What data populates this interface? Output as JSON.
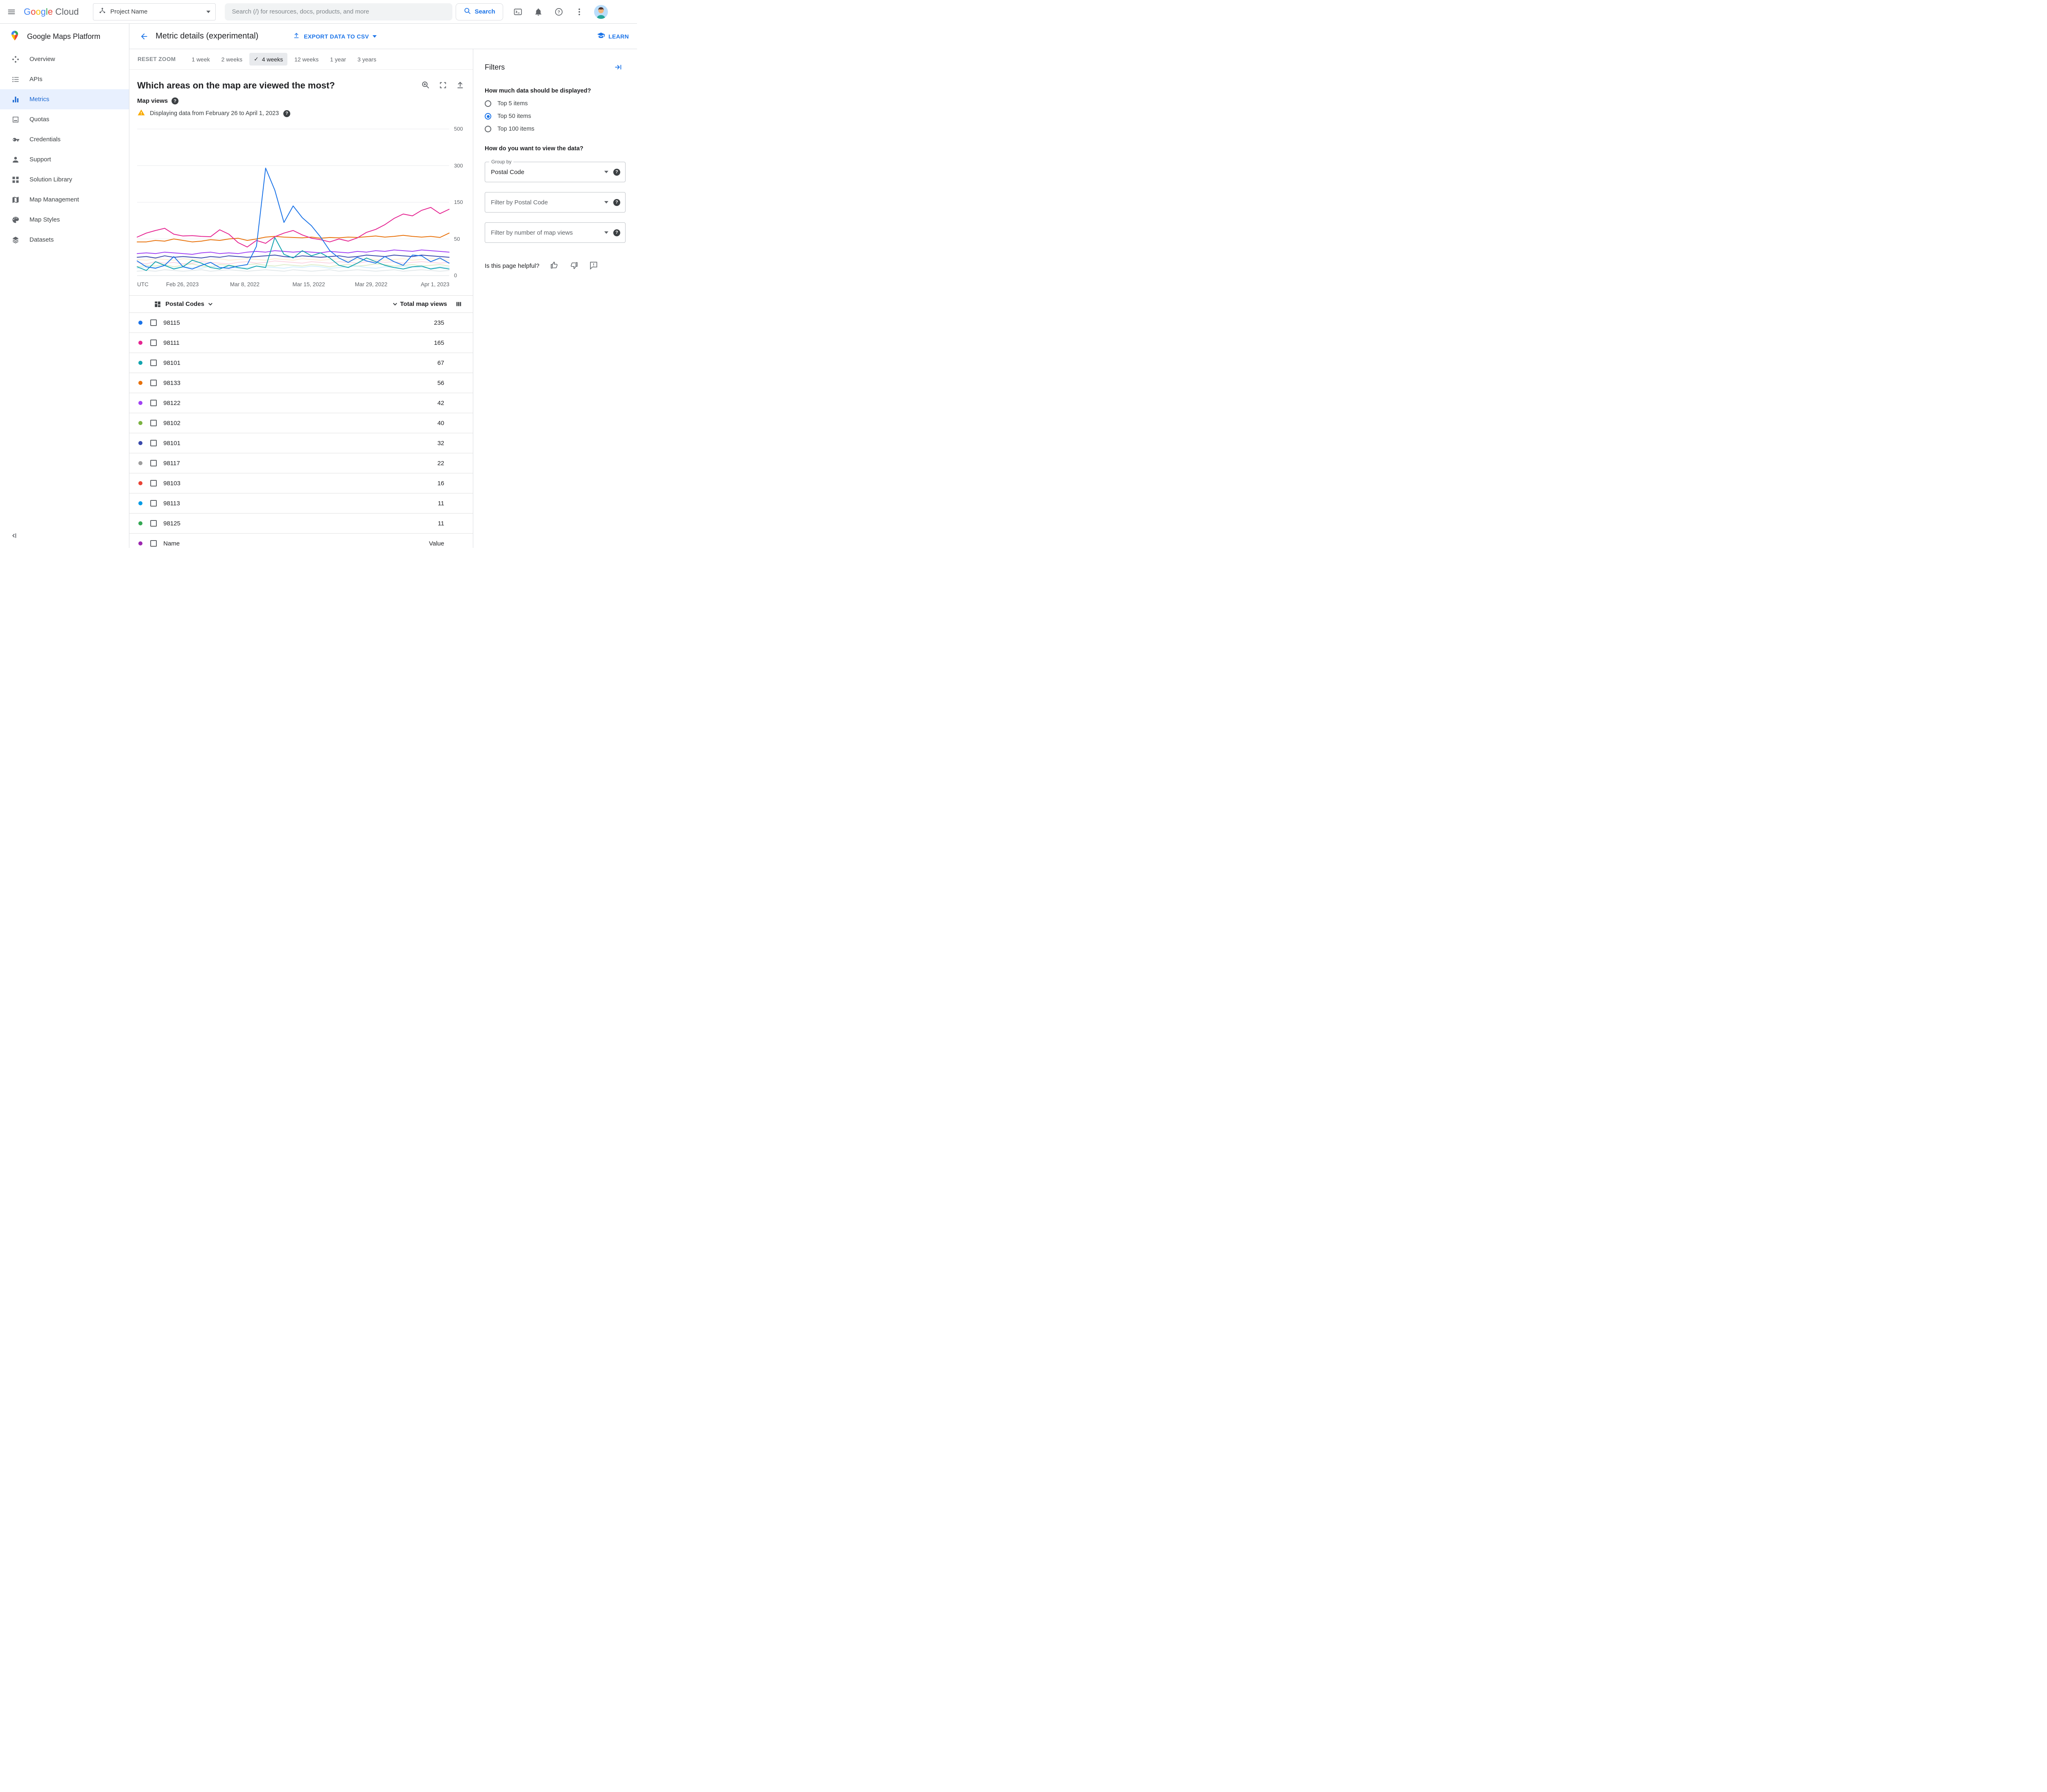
{
  "topbar": {
    "logo": {
      "brand_letters": [
        "G",
        "o",
        "o",
        "g",
        "l",
        "e"
      ],
      "letter_colors": [
        "#4285F4",
        "#EA4335",
        "#FBBC05",
        "#4285F4",
        "#34A853",
        "#EA4335"
      ],
      "suffix": "Cloud"
    },
    "project_selector": {
      "label": "Project Name"
    },
    "search": {
      "placeholder": "Search (/) for resources, docs, products, and more",
      "button_label": "Search"
    }
  },
  "sidebar": {
    "title": "Google Maps Platform",
    "items": [
      {
        "label": "Overview",
        "icon": "overview-icon",
        "active": false
      },
      {
        "label": "APIs",
        "icon": "apis-icon",
        "active": false
      },
      {
        "label": "Metrics",
        "icon": "metrics-icon",
        "active": true
      },
      {
        "label": "Quotas",
        "icon": "quotas-icon",
        "active": false
      },
      {
        "label": "Credentials",
        "icon": "credentials-icon",
        "active": false
      },
      {
        "label": "Support",
        "icon": "support-icon",
        "active": false
      },
      {
        "label": "Solution Library",
        "icon": "solution-library-icon",
        "active": false
      },
      {
        "label": "Map Management",
        "icon": "map-management-icon",
        "active": false
      },
      {
        "label": "Map Styles",
        "icon": "map-styles-icon",
        "active": false
      },
      {
        "label": "Datasets",
        "icon": "datasets-icon",
        "active": false
      }
    ]
  },
  "header": {
    "title": "Metric details (experimental)",
    "export_button": "EXPORT DATA TO CSV",
    "learn_link": "LEARN"
  },
  "time_controls": {
    "reset_label": "RESET ZOOM",
    "options": [
      {
        "label": "1 week",
        "selected": false
      },
      {
        "label": "2 weeks",
        "selected": false
      },
      {
        "label": "4 weeks",
        "selected": true
      },
      {
        "label": "12 weeks",
        "selected": false
      },
      {
        "label": "1 year",
        "selected": false
      },
      {
        "label": "3 years",
        "selected": false
      }
    ]
  },
  "chart_section": {
    "question": "Which areas on the map are viewed the most?",
    "metric_label": "Map views",
    "warning_text": "Displaying data from February 26 to April 1, 2023"
  },
  "chart_data": {
    "type": "line",
    "title": "Which areas on the map are viewed the most?",
    "ylabel": "Map views",
    "yticks": [
      0,
      50,
      150,
      300,
      500
    ],
    "grid": true,
    "timezone_label": "UTC",
    "x_axis_labels": [
      {
        "label": "Feb 26, 2023",
        "pos": 0.145
      },
      {
        "label": "Mar 8, 2022",
        "pos": 0.345
      },
      {
        "label": "Mar 15, 2022",
        "pos": 0.55
      },
      {
        "label": "Mar 29, 2022",
        "pos": 0.75
      },
      {
        "label": "Apr 1, 2023",
        "pos": 0.955
      }
    ],
    "series": [
      {
        "name": "98102",
        "color": "#c5e1a5",
        "faded": true,
        "values": [
          12,
          14,
          13,
          15,
          12,
          14,
          16,
          13,
          12,
          15,
          14,
          13,
          15,
          16,
          14,
          13,
          15,
          14,
          13,
          15,
          14,
          12,
          14,
          15,
          13,
          14,
          16,
          15,
          13,
          14,
          15,
          13,
          14,
          15,
          13
        ]
      },
      {
        "name": "98117",
        "color": "#cfd8dc",
        "faded": true,
        "values": [
          6,
          7,
          6,
          8,
          7,
          6,
          7,
          8,
          6,
          7,
          8,
          7,
          6,
          7,
          8,
          7,
          6,
          8,
          7,
          6,
          7,
          8,
          6,
          7,
          8,
          7,
          6,
          7,
          8,
          6,
          7,
          8,
          7,
          6,
          7
        ]
      },
      {
        "name": "98103",
        "color": "#f8bbd0",
        "faded": true,
        "values": [
          18,
          16,
          19,
          17,
          18,
          16,
          17,
          19,
          18,
          17,
          16,
          18,
          19,
          17,
          18,
          20,
          19,
          18,
          17,
          19,
          18,
          17,
          19,
          18,
          17,
          19,
          20,
          18,
          19,
          17,
          18,
          19,
          18,
          17,
          18
        ]
      },
      {
        "name": "98113",
        "color": "#b3e5fc",
        "faded": true,
        "values": [
          10,
          12,
          11,
          13,
          10,
          12,
          11,
          10,
          13,
          11,
          12,
          10,
          11,
          13,
          12,
          11,
          10,
          12,
          11,
          13,
          12,
          10,
          11,
          12,
          13,
          11,
          10,
          12,
          11,
          13,
          12,
          11,
          10,
          12,
          11
        ]
      },
      {
        "name": "98125",
        "color": "#ffe0b2",
        "faded": true,
        "values": [
          22,
          21,
          23,
          22,
          21,
          23,
          22,
          21,
          22,
          23,
          21,
          22,
          23,
          22,
          21,
          23,
          22,
          21,
          23,
          22,
          21,
          22,
          23,
          21,
          22,
          23,
          22,
          21,
          22,
          23,
          21,
          22,
          23,
          22,
          21
        ]
      },
      {
        "name": "98101",
        "color": "#3949ab",
        "faded": false,
        "values": [
          25,
          26,
          24,
          27,
          25,
          26,
          25,
          24,
          26,
          25,
          27,
          26,
          25,
          26,
          27,
          28,
          26,
          25,
          27,
          26,
          25,
          26,
          27,
          25,
          26,
          28,
          27,
          26,
          28,
          27,
          26,
          28,
          27,
          26,
          25
        ]
      },
      {
        "name": "98122",
        "color": "#a142f4",
        "faded": false,
        "values": [
          30,
          31,
          30,
          32,
          31,
          30,
          29,
          31,
          32,
          30,
          31,
          30,
          32,
          33,
          32,
          34,
          33,
          32,
          33,
          32,
          31,
          33,
          32,
          31,
          33,
          32,
          34,
          33,
          35,
          34,
          33,
          35,
          34,
          33,
          32
        ]
      },
      {
        "name": "98133",
        "color": "#e8710a",
        "faded": false,
        "values": [
          46,
          46,
          48,
          47,
          50,
          48,
          46,
          47,
          49,
          48,
          50,
          52,
          48,
          50,
          55,
          57,
          55,
          54,
          53,
          55,
          52,
          54,
          53,
          55,
          54,
          56,
          58,
          55,
          57,
          60,
          57,
          55,
          57,
          54,
          66
        ]
      },
      {
        "name": "98101",
        "color": "#12a4af",
        "faded": false,
        "values": [
          12,
          7,
          19,
          14,
          9,
          12,
          21,
          17,
          11,
          9,
          14,
          11,
          9,
          13,
          11,
          54,
          29,
          24,
          34,
          27,
          31,
          24,
          14,
          11,
          17,
          24,
          19,
          14,
          11,
          9,
          12,
          13,
          9,
          11,
          9
        ]
      },
      {
        "name": "98111",
        "color": "#e52592",
        "faded": false,
        "values": [
          55,
          66,
          73,
          79,
          63,
          58,
          59,
          57,
          56,
          75,
          63,
          45,
          39,
          48,
          44,
          56,
          66,
          73,
          61,
          52,
          49,
          46,
          50,
          47,
          53,
          68,
          76,
          89,
          106,
          118,
          113,
          128,
          136,
          119,
          131
        ]
      },
      {
        "name": "98115",
        "color": "#1a73e8",
        "faded": false,
        "values": [
          20,
          12,
          10,
          14,
          26,
          12,
          9,
          14,
          18,
          11,
          10,
          13,
          15,
          40,
          290,
          200,
          95,
          140,
          108,
          86,
          55,
          34,
          24,
          18,
          25,
          20,
          17,
          26,
          19,
          14,
          28,
          27,
          19,
          24,
          17
        ]
      }
    ]
  },
  "table": {
    "group_header": "Postal Codes",
    "value_header": "Total map views",
    "rows": [
      {
        "label": "98115",
        "value": "235",
        "color": "#1a73e8"
      },
      {
        "label": "98111",
        "value": "165",
        "color": "#e52592"
      },
      {
        "label": "98101",
        "value": "67",
        "color": "#12a4af"
      },
      {
        "label": "98133",
        "value": "56",
        "color": "#e8710a"
      },
      {
        "label": "98122",
        "value": "42",
        "color": "#a142f4"
      },
      {
        "label": "98102",
        "value": "40",
        "color": "#7cb342"
      },
      {
        "label": "98101",
        "value": "32",
        "color": "#3949ab"
      },
      {
        "label": "98117",
        "value": "22",
        "color": "#9e9e9e"
      },
      {
        "label": "98103",
        "value": "16",
        "color": "#ea4335"
      },
      {
        "label": "98113",
        "value": "11",
        "color": "#039be5"
      },
      {
        "label": "98125",
        "value": "11",
        "color": "#34a853"
      },
      {
        "label": "Name",
        "value": "Value",
        "color": "#9c27b0"
      }
    ]
  },
  "filters": {
    "title": "Filters",
    "q1": "How much data should be displayed?",
    "radio_options": [
      {
        "label": "Top 5 items",
        "selected": false
      },
      {
        "label": "Top 50 items",
        "selected": true
      },
      {
        "label": "Top 100 items",
        "selected": false
      }
    ],
    "q2": "How do you want to view the data?",
    "group_by_label": "Group by",
    "group_by_value": "Postal Code",
    "filter1_placeholder": "Filter by Postal Code",
    "filter2_placeholder": "Filter by number of map views",
    "helpful": "Is this page helpful?"
  }
}
